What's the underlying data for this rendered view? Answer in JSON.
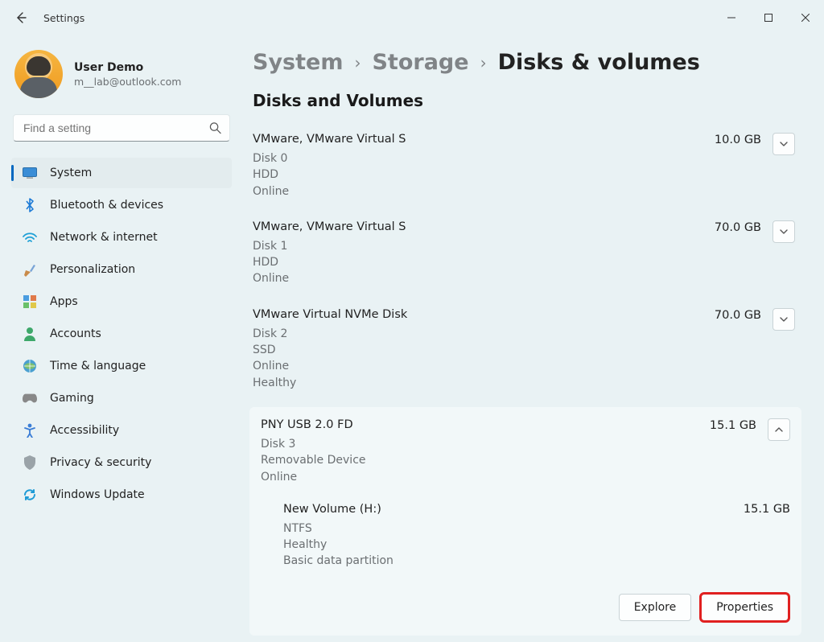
{
  "app_title": "Settings",
  "profile": {
    "name": "User Demo",
    "email": "m__lab@outlook.com"
  },
  "search": {
    "placeholder": "Find a setting"
  },
  "sidebar": {
    "items": [
      {
        "label": "System",
        "icon": "system",
        "selected": true
      },
      {
        "label": "Bluetooth & devices",
        "icon": "bluetooth"
      },
      {
        "label": "Network & internet",
        "icon": "network"
      },
      {
        "label": "Personalization",
        "icon": "personalization"
      },
      {
        "label": "Apps",
        "icon": "apps"
      },
      {
        "label": "Accounts",
        "icon": "accounts"
      },
      {
        "label": "Time & language",
        "icon": "time"
      },
      {
        "label": "Gaming",
        "icon": "gaming"
      },
      {
        "label": "Accessibility",
        "icon": "accessibility"
      },
      {
        "label": "Privacy & security",
        "icon": "privacy"
      },
      {
        "label": "Windows Update",
        "icon": "update"
      }
    ]
  },
  "breadcrumb": {
    "system": "System",
    "storage": "Storage",
    "current": "Disks & volumes"
  },
  "section_title": "Disks and Volumes",
  "disks": [
    {
      "name": "VMware, VMware Virtual S",
      "size": "10.0 GB",
      "disk_label": "Disk 0",
      "bus": "HDD",
      "status": "Online",
      "expanded": false
    },
    {
      "name": "VMware, VMware Virtual S",
      "size": "70.0 GB",
      "disk_label": "Disk 1",
      "bus": "HDD",
      "status": "Online",
      "expanded": false
    },
    {
      "name": "VMware Virtual NVMe Disk",
      "size": "70.0 GB",
      "disk_label": "Disk 2",
      "bus": "SSD",
      "status": "Online",
      "health": "Healthy",
      "expanded": false
    },
    {
      "name": "PNY USB 2.0 FD",
      "size": "15.1 GB",
      "disk_label": "Disk 3",
      "bus": "Removable Device",
      "status": "Online",
      "expanded": true,
      "volumes": [
        {
          "name": "New Volume (H:)",
          "size": "15.1 GB",
          "fs": "NTFS",
          "health": "Healthy",
          "type": "Basic data partition"
        }
      ]
    }
  ],
  "actions": {
    "explore": "Explore",
    "properties": "Properties"
  }
}
